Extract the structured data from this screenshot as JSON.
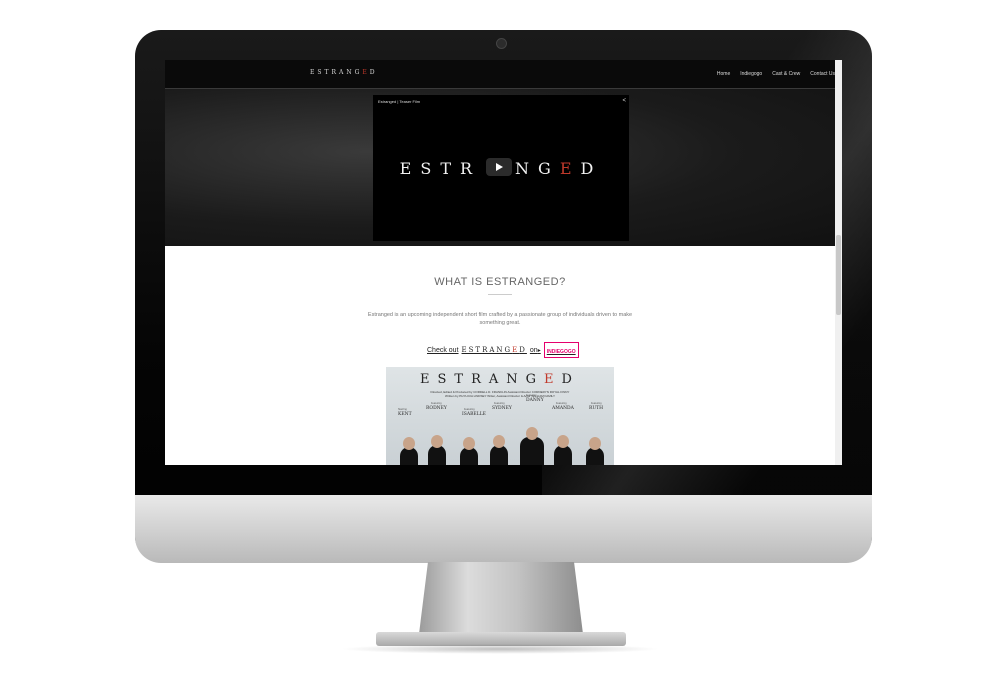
{
  "site": {
    "brand": {
      "pre": "ESTRANG",
      "accent": "E",
      "post": "D"
    },
    "nav": [
      "Home",
      "Indiegogo",
      "Cast & Crew",
      "Contact Us"
    ]
  },
  "video": {
    "title": "Estranged | Teaser Film",
    "logo": {
      "pre": "ESTR",
      "post": "NG",
      "accent": "E",
      "end": "D"
    }
  },
  "about": {
    "heading": "WHAT IS ESTRANGED?",
    "description": "Estranged is an upcoming independent short film crafted by a passionate group of individuals driven to make something great.",
    "cta": {
      "prefix": "Check out",
      "word_pre": "ESTRANG",
      "word_accent": "E",
      "word_post": "D",
      "suffix": "on",
      "platform": "INDIEGOGO"
    }
  },
  "poster": {
    "title": {
      "pre": "ESTRANG",
      "accent": "E",
      "post": "D"
    },
    "credits_line1": "Directed, Edited & Produced by CORDELL D. FRANKLIN   Assistant Director CORDERYN ROYAL FINNY",
    "credits_line2": "Written by PHYLICIA LINDSEY   Writer, Assistant Director & Actor WILLIAM FAMILY",
    "cast": [
      {
        "role": "Starring",
        "name": "KENT"
      },
      {
        "role": "Featuring",
        "name": "RODNEY"
      },
      {
        "role": "Featuring",
        "name": "ISABELLE"
      },
      {
        "role": "Featuring",
        "name": "SYDNEY"
      },
      {
        "role": "Featuring",
        "name": "DANNY"
      },
      {
        "role": "Featuring",
        "name": "AMANDA"
      },
      {
        "role": "Featuring",
        "name": "RUTH"
      }
    ]
  },
  "colors": {
    "accent": "#c0392b",
    "indiegogo": "#e5006d",
    "nav_bg": "#0a0a0a"
  }
}
